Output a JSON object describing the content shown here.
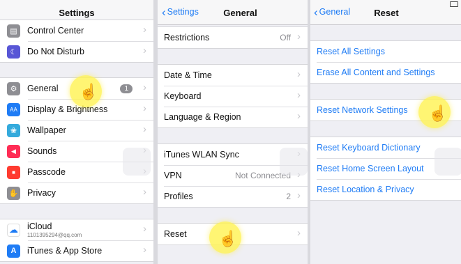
{
  "panel1": {
    "title": "Settings",
    "group1": [
      {
        "label": "Control Center",
        "icon": "control-center-icon",
        "color": "#8e8e93",
        "glyph": "▤"
      },
      {
        "label": "Do Not Disturb",
        "icon": "moon-icon",
        "color": "#5856d6",
        "glyph": "☾"
      }
    ],
    "group2": [
      {
        "label": "General",
        "icon": "gear-icon",
        "color": "#8e8e93",
        "glyph": "⚙",
        "badge": "1"
      },
      {
        "label": "Display & Brightness",
        "icon": "display-brightness-icon",
        "color": "#1f7cf5",
        "glyph": "AA"
      },
      {
        "label": "Wallpaper",
        "icon": "wallpaper-icon",
        "color": "#34aadc",
        "glyph": "❀"
      },
      {
        "label": "Sounds",
        "icon": "sounds-icon",
        "color": "#ff2d55",
        "glyph": "◀"
      },
      {
        "label": "Passcode",
        "icon": "lock-icon",
        "color": "#ff3b30",
        "glyph": "■"
      },
      {
        "label": "Privacy",
        "icon": "hand-icon",
        "color": "#8e8e93",
        "glyph": "✋"
      }
    ],
    "group3": [
      {
        "label": "iCloud",
        "sub": "1101395294@qq.com",
        "icon": "icloud-icon",
        "color": "#ffffff",
        "glyph": "☁"
      },
      {
        "label": "iTunes & App Store",
        "icon": "app-store-icon",
        "color": "#1f7cf5",
        "glyph": "A"
      }
    ]
  },
  "panel2": {
    "back": "Settings",
    "title": "General",
    "restrictions": {
      "label": "Restrictions",
      "value": "Off"
    },
    "group2": [
      {
        "label": "Date & Time"
      },
      {
        "label": "Keyboard"
      },
      {
        "label": "Language & Region"
      }
    ],
    "group3": [
      {
        "label": "iTunes WLAN Sync",
        "value": ""
      },
      {
        "label": "VPN",
        "value": "Not Connected"
      },
      {
        "label": "Profiles",
        "value": "2"
      }
    ],
    "reset": {
      "label": "Reset"
    }
  },
  "panel3": {
    "back": "General",
    "title": "Reset",
    "group1": [
      "Reset All Settings",
      "Erase All Content and Settings"
    ],
    "group2": [
      "Reset Network Settings"
    ],
    "group3": [
      "Reset Keyboard Dictionary",
      "Reset Home Screen Layout",
      "Reset Location & Privacy"
    ]
  },
  "chevron": "›",
  "tap_color": "#fff250"
}
